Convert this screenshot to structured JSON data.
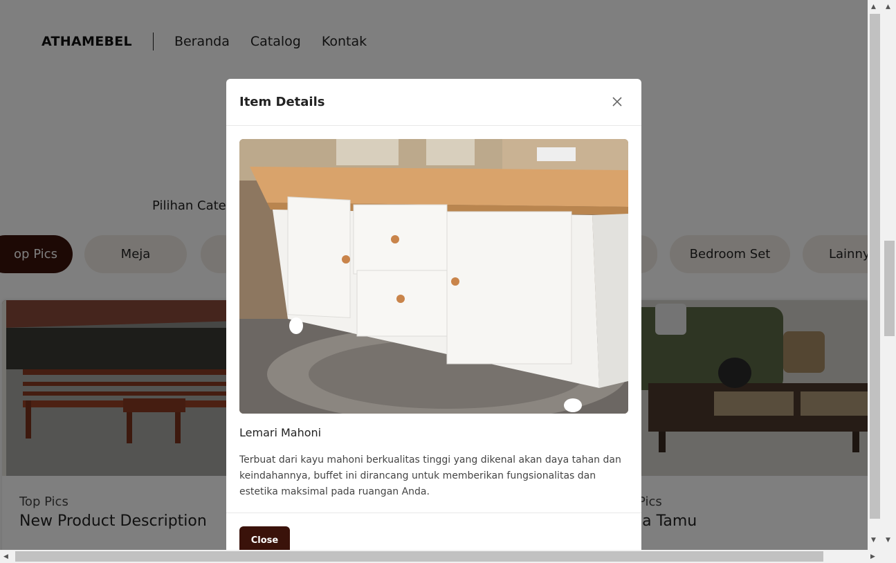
{
  "navbar": {
    "brand": "ATHAMEBEL",
    "links": [
      "Beranda",
      "Catalog",
      "Kontak"
    ]
  },
  "categories": {
    "heading": "Pilihan Cate",
    "pills": [
      "op Pics",
      "Meja",
      "Bedroom Set",
      "Lainny"
    ]
  },
  "cards": [
    {
      "category": "Top Pics",
      "name": "New Product Description"
    },
    {
      "category": "Pics",
      "name": "ja Tamu"
    }
  ],
  "modal": {
    "title": "Item Details",
    "item_name": "Lemari Mahoni",
    "description": "Terbuat dari kayu mahoni berkualitas tinggi yang dikenal akan daya tahan dan keindahannya, buffet ini dirancang untuk memberikan fungsionalitas dan estetika maksimal pada ruangan Anda.",
    "close_label": "Close"
  },
  "colors": {
    "accent": "#3a120a",
    "pill_bg": "#f1ebe4"
  }
}
